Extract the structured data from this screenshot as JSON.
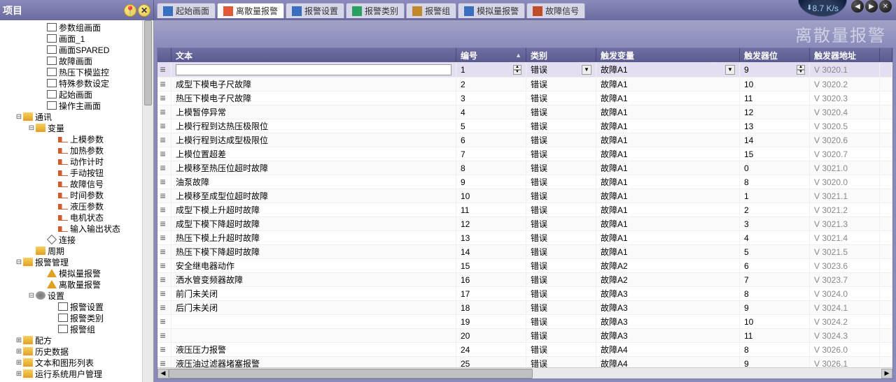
{
  "panel_title": "项目",
  "speed": "8.7 K/s",
  "tabs": [
    {
      "label": "起始画面",
      "color": "#3a6fbf"
    },
    {
      "label": "离散量报警",
      "color": "#e05a3a",
      "active": true
    },
    {
      "label": "报警设置",
      "color": "#3a6fbf"
    },
    {
      "label": "报警类别",
      "color": "#2aa060"
    },
    {
      "label": "报警组",
      "color": "#c08a2a"
    },
    {
      "label": "模拟量报警",
      "color": "#3a6fbf"
    },
    {
      "label": "故障信号",
      "color": "#c04a2a"
    }
  ],
  "banner": "离散量报警",
  "tree": [
    {
      "ind": 56,
      "ic": "rect",
      "label": "参数组画面"
    },
    {
      "ind": 56,
      "ic": "rect",
      "label": "画面_1"
    },
    {
      "ind": 56,
      "ic": "rect",
      "label": "画面SPARED"
    },
    {
      "ind": 56,
      "ic": "rect",
      "label": "故障画面"
    },
    {
      "ind": 56,
      "ic": "rect",
      "label": "热压下模监控"
    },
    {
      "ind": 56,
      "ic": "rect",
      "label": "特殊参数设定"
    },
    {
      "ind": 56,
      "ic": "rect",
      "label": "起始画面"
    },
    {
      "ind": 56,
      "ic": "rect",
      "label": "操作主画面"
    },
    {
      "ind": 22,
      "exp": "-",
      "ic": "folder",
      "label": "通讯"
    },
    {
      "ind": 40,
      "exp": "-",
      "ic": "folder",
      "label": "变量"
    },
    {
      "ind": 72,
      "ic": "tag",
      "label": "上模参数"
    },
    {
      "ind": 72,
      "ic": "tag",
      "label": "加热参数"
    },
    {
      "ind": 72,
      "ic": "tag",
      "label": "动作计时"
    },
    {
      "ind": 72,
      "ic": "tag",
      "label": "手动按钮"
    },
    {
      "ind": 72,
      "ic": "tag",
      "label": "故障信号"
    },
    {
      "ind": 72,
      "ic": "tag",
      "label": "时间参数"
    },
    {
      "ind": 72,
      "ic": "tag",
      "label": "液压参数"
    },
    {
      "ind": 72,
      "ic": "tag",
      "label": "电机状态"
    },
    {
      "ind": 72,
      "ic": "tag",
      "label": "输入输出状态"
    },
    {
      "ind": 56,
      "ic": "conn",
      "label": "连接"
    },
    {
      "ind": 40,
      "ic": "folder",
      "label": "周期"
    },
    {
      "ind": 22,
      "exp": "-",
      "ic": "folder",
      "label": "报警管理"
    },
    {
      "ind": 56,
      "ic": "alarm",
      "label": "模拟量报警"
    },
    {
      "ind": 56,
      "ic": "alarm",
      "label": "离散量报警"
    },
    {
      "ind": 40,
      "exp": "-",
      "ic": "set",
      "label": "设置"
    },
    {
      "ind": 72,
      "ic": "rect",
      "label": "报警设置"
    },
    {
      "ind": 72,
      "ic": "rect",
      "label": "报警类别"
    },
    {
      "ind": 72,
      "ic": "rect",
      "label": "报警组"
    },
    {
      "ind": 22,
      "exp": "+",
      "ic": "folder",
      "label": "配方"
    },
    {
      "ind": 22,
      "exp": "+",
      "ic": "folder",
      "label": "历史数据"
    },
    {
      "ind": 22,
      "exp": "+",
      "ic": "folder",
      "label": "文本和图形列表"
    },
    {
      "ind": 22,
      "exp": "+",
      "ic": "folder",
      "label": "运行系统用户管理"
    }
  ],
  "grid": {
    "headers": {
      "text": "文本",
      "id": "编号",
      "cat": "类别",
      "var": "触发变量",
      "bit": "触发器位",
      "addr": "触发器地址"
    },
    "filter": {
      "id": "1",
      "cat": "错误",
      "var": "故障A1",
      "bit": "9",
      "addr": "V 3020.1"
    },
    "rows": [
      {
        "text": "成型下模电子尺故障",
        "id": "2",
        "cat": "错误",
        "var": "故障A1",
        "bit": "10",
        "addr": "V 3020.2"
      },
      {
        "text": "热压下模电子尺故障",
        "id": "3",
        "cat": "错误",
        "var": "故障A1",
        "bit": "11",
        "addr": "V 3020.3"
      },
      {
        "text": "上模暂停异常",
        "id": "4",
        "cat": "错误",
        "var": "故障A1",
        "bit": "12",
        "addr": "V 3020.4"
      },
      {
        "text": "上模行程到达热压极限位",
        "id": "5",
        "cat": "错误",
        "var": "故障A1",
        "bit": "13",
        "addr": "V 3020.5"
      },
      {
        "text": "上模行程到达成型极限位",
        "id": "6",
        "cat": "错误",
        "var": "故障A1",
        "bit": "14",
        "addr": "V 3020.6"
      },
      {
        "text": "上模位置超差",
        "id": "7",
        "cat": "错误",
        "var": "故障A1",
        "bit": "15",
        "addr": "V 3020.7"
      },
      {
        "text": "上模移至热压位超时故障",
        "id": "8",
        "cat": "错误",
        "var": "故障A1",
        "bit": "0",
        "addr": "V 3021.0"
      },
      {
        "text": "油泵故障",
        "id": "9",
        "cat": "错误",
        "var": "故障A1",
        "bit": "8",
        "addr": "V 3020.0"
      },
      {
        "text": "上模移至成型位超时故障",
        "id": "10",
        "cat": "错误",
        "var": "故障A1",
        "bit": "1",
        "addr": "V 3021.1"
      },
      {
        "text": "成型下模上升超时故障",
        "id": "11",
        "cat": "错误",
        "var": "故障A1",
        "bit": "2",
        "addr": "V 3021.2"
      },
      {
        "text": "成型下模下降超时故障",
        "id": "12",
        "cat": "错误",
        "var": "故障A1",
        "bit": "3",
        "addr": "V 3021.3"
      },
      {
        "text": "热压下模上升超时故障",
        "id": "13",
        "cat": "错误",
        "var": "故障A1",
        "bit": "4",
        "addr": "V 3021.4"
      },
      {
        "text": "热压下模下降超时故障",
        "id": "14",
        "cat": "错误",
        "var": "故障A1",
        "bit": "5",
        "addr": "V 3021.5"
      },
      {
        "text": "安全继电器动作",
        "id": "15",
        "cat": "错误",
        "var": "故障A2",
        "bit": "6",
        "addr": "V 3023.6"
      },
      {
        "text": "洒水管变频器故障",
        "id": "16",
        "cat": "错误",
        "var": "故障A2",
        "bit": "7",
        "addr": "V 3023.7"
      },
      {
        "text": "前门未关闭",
        "id": "17",
        "cat": "错误",
        "var": "故障A3",
        "bit": "8",
        "addr": "V 3024.0"
      },
      {
        "text": "后门未关闭",
        "id": "18",
        "cat": "错误",
        "var": "故障A3",
        "bit": "9",
        "addr": "V 3024.1"
      },
      {
        "text": "",
        "id": "19",
        "cat": "错误",
        "var": "故障A3",
        "bit": "10",
        "addr": "V 3024.2"
      },
      {
        "text": "",
        "id": "20",
        "cat": "错误",
        "var": "故障A3",
        "bit": "11",
        "addr": "V 3024.3"
      },
      {
        "text": "液压压力报警",
        "id": "24",
        "cat": "错误",
        "var": "故障A4",
        "bit": "8",
        "addr": "V 3026.0"
      },
      {
        "text": "液压油过滤器堵塞报警",
        "id": "25",
        "cat": "错误",
        "var": "故障A4",
        "bit": "9",
        "addr": "V 3026.1"
      }
    ]
  }
}
